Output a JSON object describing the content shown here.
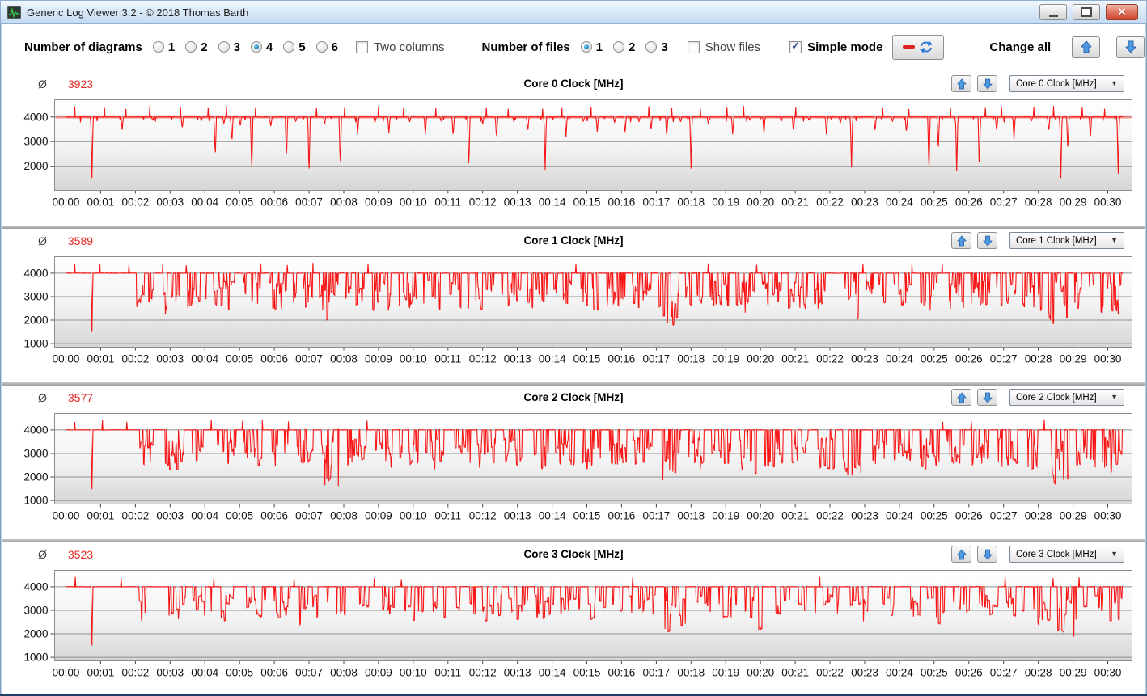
{
  "window": {
    "title": "Generic Log Viewer 3.2 - © 2018 Thomas Barth"
  },
  "titlebar_buttons": {
    "minimize": "minimize",
    "maximize": "maximize",
    "close": "close"
  },
  "colors": {
    "line_red": "#f81616",
    "avg_text_red": "#e62a24",
    "arrow_blue": "#4e9ae0",
    "titlebar_blue": "#c3d9f0",
    "frame_blue": "#bed4ec",
    "grid_gray": "#909090"
  },
  "toolbar": {
    "diagrams": {
      "label": "Number of diagrams",
      "options": [
        {
          "label": "1",
          "selected": false
        },
        {
          "label": "2",
          "selected": false
        },
        {
          "label": "3",
          "selected": false
        },
        {
          "label": "4",
          "selected": true
        },
        {
          "label": "5",
          "selected": false
        },
        {
          "label": "6",
          "selected": false
        }
      ]
    },
    "two_columns": {
      "label": "Two columns",
      "checked": false
    },
    "files": {
      "label": "Number of files",
      "options": [
        {
          "label": "1",
          "selected": true
        },
        {
          "label": "2",
          "selected": false
        },
        {
          "label": "3",
          "selected": false
        }
      ]
    },
    "show_files": {
      "label": "Show files",
      "checked": false
    },
    "simple_mode": {
      "label": "Simple mode",
      "checked": true
    },
    "refresh_button": {
      "icons": [
        "red-line-icon",
        "refresh-arrows-icon"
      ]
    },
    "change_all": {
      "label": "Change all",
      "buttons": [
        "up-arrow-icon",
        "down-arrow-icon"
      ]
    }
  },
  "panels_common": {
    "avg_symbol": "Ø",
    "chevron": "▼"
  },
  "chart_data": [
    {
      "type": "line",
      "title": "Core 0 Clock [MHz]",
      "average": 3923,
      "selector_value": "Core 0 Clock [MHz]",
      "ylabel": "",
      "xlabel": "",
      "ylim": [
        1020,
        4700
      ],
      "y_ticks": [
        4000,
        3000,
        2000
      ],
      "x_ticks": [
        "00:00",
        "00:01",
        "00:02",
        "00:03",
        "00:04",
        "00:05",
        "00:06",
        "00:07",
        "00:08",
        "00:09",
        "00:10",
        "00:11",
        "00:12",
        "00:13",
        "00:14",
        "00:15",
        "00:16",
        "00:17",
        "00:18",
        "00:19",
        "00:20",
        "00:21",
        "00:22",
        "00:23",
        "00:24",
        "00:25",
        "00:26",
        "00:27",
        "00:28",
        "00:29",
        "00:30"
      ],
      "grid": true,
      "legend": "none",
      "line_color": "#f81616",
      "baseline": 4000,
      "spike_max": 4450,
      "avg_band": true,
      "micro_dips": true,
      "seed": 11,
      "up_ratio": 0.45,
      "hold": 3,
      "dips": [
        [
          0.75,
          1520
        ],
        [
          1.62,
          3480
        ],
        [
          2.5,
          3850
        ],
        [
          3.35,
          3520
        ],
        [
          3.9,
          3850
        ],
        [
          4.3,
          2330
        ],
        [
          4.55,
          3700
        ],
        [
          4.78,
          2950
        ],
        [
          5.02,
          3600
        ],
        [
          5.35,
          1680
        ],
        [
          5.9,
          3570
        ],
        [
          6.35,
          2230
        ],
        [
          6.62,
          3800
        ],
        [
          7.0,
          1560
        ],
        [
          7.45,
          3700
        ],
        [
          7.9,
          1900
        ],
        [
          8.4,
          3300
        ],
        [
          8.9,
          3750
        ],
        [
          9.3,
          3350
        ],
        [
          9.9,
          3800
        ],
        [
          10.35,
          3300
        ],
        [
          10.8,
          3850
        ],
        [
          11.15,
          3200
        ],
        [
          11.6,
          1800
        ],
        [
          12.0,
          3700
        ],
        [
          12.4,
          3100
        ],
        [
          12.9,
          3800
        ],
        [
          13.3,
          3400
        ],
        [
          13.8,
          1850
        ],
        [
          14.4,
          3200
        ],
        [
          14.9,
          3800
        ],
        [
          15.3,
          3400
        ],
        [
          15.8,
          3750
        ],
        [
          16.1,
          3300
        ],
        [
          16.5,
          3800
        ],
        [
          16.85,
          3450
        ],
        [
          17.3,
          3200
        ],
        [
          17.7,
          3800
        ],
        [
          18.0,
          1900
        ],
        [
          18.5,
          3700
        ],
        [
          19.2,
          3300
        ],
        [
          19.7,
          3850
        ],
        [
          20.1,
          3350
        ],
        [
          20.6,
          3800
        ],
        [
          20.95,
          3400
        ],
        [
          21.4,
          3850
        ],
        [
          21.9,
          3300
        ],
        [
          22.3,
          3750
        ],
        [
          22.62,
          1950
        ],
        [
          23.3,
          3400
        ],
        [
          23.8,
          3800
        ],
        [
          24.2,
          3350
        ],
        [
          24.85,
          1700
        ],
        [
          25.12,
          2600
        ],
        [
          25.65,
          1800
        ],
        [
          26.3,
          1850
        ],
        [
          26.8,
          3400
        ],
        [
          27.3,
          3100
        ],
        [
          27.8,
          3800
        ],
        [
          28.3,
          3400
        ],
        [
          28.65,
          1520
        ],
        [
          28.85,
          2600
        ],
        [
          29.5,
          3100
        ],
        [
          30.3,
          1700
        ]
      ],
      "bursts": []
    },
    {
      "type": "line",
      "title": "Core 1 Clock [MHz]",
      "average": 3589,
      "selector_value": "Core 1 Clock [MHz]",
      "ylabel": "",
      "xlabel": "",
      "ylim": [
        850,
        4700
      ],
      "y_ticks": [
        4000,
        3000,
        2000,
        1000
      ],
      "x_ticks": [
        "00:00",
        "00:01",
        "00:02",
        "00:03",
        "00:04",
        "00:05",
        "00:06",
        "00:07",
        "00:08",
        "00:09",
        "00:10",
        "00:11",
        "00:12",
        "00:13",
        "00:14",
        "00:15",
        "00:16",
        "00:17",
        "00:18",
        "00:19",
        "00:20",
        "00:21",
        "00:22",
        "00:23",
        "00:24",
        "00:25",
        "00:26",
        "00:27",
        "00:28",
        "00:29",
        "00:30"
      ],
      "grid": true,
      "legend": "none",
      "line_color": "#f81616",
      "baseline": 4000,
      "spike_max": 4450,
      "avg_band": false,
      "micro_dips": false,
      "seed": 23,
      "up_ratio": 0.45,
      "hold": 3,
      "dips": [
        [
          0.75,
          1500,
          0.03
        ]
      ],
      "bursts": [
        [
          2.0,
          2.55,
          2500
        ],
        [
          2.8,
          3.3,
          2100
        ],
        [
          3.5,
          4.05,
          2500
        ],
        [
          4.25,
          4.85,
          2400
        ],
        [
          5.05,
          5.6,
          2550
        ],
        [
          5.8,
          6.35,
          2300
        ],
        [
          6.55,
          7.1,
          2500
        ],
        [
          7.3,
          7.85,
          1450
        ],
        [
          8.05,
          8.6,
          2500
        ],
        [
          8.8,
          9.35,
          2400
        ],
        [
          9.55,
          10.1,
          2550
        ],
        [
          10.3,
          10.85,
          2300
        ],
        [
          11.05,
          11.6,
          2500
        ],
        [
          11.8,
          12.35,
          2400
        ],
        [
          12.55,
          13.1,
          2550
        ],
        [
          13.3,
          13.85,
          2300
        ],
        [
          14.05,
          14.6,
          2500
        ],
        [
          14.8,
          15.35,
          2400
        ],
        [
          15.55,
          16.1,
          2500
        ],
        [
          16.3,
          16.85,
          2450
        ],
        [
          17.05,
          17.65,
          1800
        ],
        [
          17.85,
          18.35,
          2400
        ],
        [
          18.55,
          19.1,
          2500
        ],
        [
          19.3,
          19.85,
          2300
        ],
        [
          20.05,
          20.6,
          2450
        ],
        [
          20.8,
          21.35,
          2500
        ],
        [
          21.55,
          22.1,
          2400
        ],
        [
          22.3,
          22.85,
          2000
        ],
        [
          23.05,
          23.6,
          2450
        ],
        [
          23.8,
          24.35,
          2500
        ],
        [
          24.55,
          25.1,
          2300
        ],
        [
          25.3,
          25.85,
          2450
        ],
        [
          26.05,
          26.6,
          2500
        ],
        [
          26.8,
          27.35,
          2400
        ],
        [
          27.55,
          28.1,
          2300
        ],
        [
          28.3,
          28.85,
          1550
        ],
        [
          29.05,
          29.6,
          2400
        ],
        [
          29.8,
          30.42,
          2200
        ]
      ]
    },
    {
      "type": "line",
      "title": "Core 2 Clock [MHz]",
      "average": 3577,
      "selector_value": "Core 2 Clock [MHz]",
      "ylabel": "",
      "xlabel": "",
      "ylim": [
        850,
        4700
      ],
      "y_ticks": [
        4000,
        3000,
        2000,
        1000
      ],
      "x_ticks": [
        "00:00",
        "00:01",
        "00:02",
        "00:03",
        "00:04",
        "00:05",
        "00:06",
        "00:07",
        "00:08",
        "00:09",
        "00:10",
        "00:11",
        "00:12",
        "00:13",
        "00:14",
        "00:15",
        "00:16",
        "00:17",
        "00:18",
        "00:19",
        "00:20",
        "00:21",
        "00:22",
        "00:23",
        "00:24",
        "00:25",
        "00:26",
        "00:27",
        "00:28",
        "00:29",
        "00:30"
      ],
      "grid": true,
      "legend": "none",
      "line_color": "#f81616",
      "baseline": 4000,
      "spike_max": 4450,
      "avg_band": false,
      "micro_dips": false,
      "seed": 57,
      "up_ratio": 0.45,
      "hold": 3,
      "dips": [
        [
          0.75,
          1480,
          0.03
        ]
      ],
      "bursts": [
        [
          2.1,
          2.6,
          2400
        ],
        [
          2.85,
          3.4,
          2200
        ],
        [
          3.6,
          4.1,
          2500
        ],
        [
          4.3,
          4.9,
          2350
        ],
        [
          5.1,
          5.65,
          2500
        ],
        [
          5.85,
          6.4,
          2250
        ],
        [
          6.6,
          7.15,
          2450
        ],
        [
          7.35,
          7.9,
          1500
        ],
        [
          8.1,
          8.65,
          2500
        ],
        [
          8.85,
          9.4,
          2350
        ],
        [
          9.6,
          10.15,
          2500
        ],
        [
          10.35,
          10.9,
          2250
        ],
        [
          11.1,
          11.65,
          2500
        ],
        [
          11.85,
          12.4,
          2350
        ],
        [
          12.6,
          13.15,
          2500
        ],
        [
          13.35,
          13.9,
          2250
        ],
        [
          14.1,
          14.65,
          2500
        ],
        [
          14.85,
          15.4,
          2350
        ],
        [
          15.6,
          16.15,
          2500
        ],
        [
          16.35,
          16.9,
          2400
        ],
        [
          17.1,
          17.7,
          1850
        ],
        [
          17.9,
          18.4,
          2350
        ],
        [
          18.6,
          19.15,
          2500
        ],
        [
          19.35,
          19.9,
          2150
        ],
        [
          20.1,
          20.65,
          2400
        ],
        [
          20.85,
          21.4,
          2500
        ],
        [
          21.6,
          22.15,
          2350
        ],
        [
          22.35,
          22.9,
          2050
        ],
        [
          23.1,
          23.65,
          2400
        ],
        [
          23.85,
          24.4,
          2500
        ],
        [
          24.6,
          25.15,
          2250
        ],
        [
          25.35,
          25.9,
          2400
        ],
        [
          26.1,
          26.65,
          2500
        ],
        [
          26.85,
          27.4,
          2350
        ],
        [
          27.6,
          28.15,
          2250
        ],
        [
          28.35,
          28.9,
          1600
        ],
        [
          29.1,
          29.65,
          2350
        ],
        [
          29.85,
          30.42,
          2150
        ]
      ]
    },
    {
      "type": "line",
      "title": "Core 3 Clock [MHz]",
      "average": 3523,
      "selector_value": "Core 3 Clock [MHz]",
      "ylabel": "",
      "xlabel": "",
      "ylim": [
        850,
        4700
      ],
      "y_ticks": [
        4000,
        3000,
        2000,
        1000
      ],
      "x_ticks": [
        "00:00",
        "00:01",
        "00:02",
        "00:03",
        "00:04",
        "00:05",
        "00:06",
        "00:07",
        "00:08",
        "00:09",
        "00:10",
        "00:11",
        "00:12",
        "00:13",
        "00:14",
        "00:15",
        "00:16",
        "00:17",
        "00:18",
        "00:19",
        "00:20",
        "00:21",
        "00:22",
        "00:23",
        "00:24",
        "00:25",
        "00:26",
        "00:27",
        "00:28",
        "00:29",
        "00:30"
      ],
      "grid": true,
      "legend": "none",
      "line_color": "#f81616",
      "baseline": 4000,
      "spike_max": 4450,
      "avg_band": false,
      "micro_dips": false,
      "seed": 83,
      "up_ratio": 0.5,
      "hold": 5,
      "dips": [
        [
          0.75,
          1500,
          0.03
        ]
      ],
      "bursts": [
        [
          2.05,
          2.65,
          2600
        ],
        [
          2.9,
          3.45,
          2650
        ],
        [
          3.65,
          4.2,
          2550
        ],
        [
          4.4,
          5.0,
          2300
        ],
        [
          5.2,
          5.75,
          2650
        ],
        [
          5.95,
          6.5,
          2600
        ],
        [
          6.7,
          7.25,
          2250
        ],
        [
          7.45,
          8.05,
          1550
        ],
        [
          8.25,
          8.8,
          2600
        ],
        [
          9.0,
          9.55,
          2650
        ],
        [
          9.75,
          10.3,
          2550
        ],
        [
          10.5,
          11.05,
          2600
        ],
        [
          11.25,
          11.8,
          2650
        ],
        [
          12.0,
          12.55,
          2550
        ],
        [
          12.75,
          13.3,
          2600
        ],
        [
          13.5,
          14.05,
          2650
        ],
        [
          14.25,
          14.8,
          2550
        ],
        [
          15.0,
          15.55,
          2600
        ],
        [
          15.75,
          16.3,
          2650
        ],
        [
          16.5,
          17.05,
          2550
        ],
        [
          17.25,
          17.85,
          1900
        ],
        [
          18.05,
          18.6,
          2600
        ],
        [
          18.8,
          19.35,
          2650
        ],
        [
          19.55,
          20.1,
          2200
        ],
        [
          20.3,
          20.85,
          2550
        ],
        [
          21.05,
          21.6,
          2600
        ],
        [
          21.8,
          22.35,
          2650
        ],
        [
          22.55,
          23.1,
          2100
        ],
        [
          23.3,
          23.85,
          2550
        ],
        [
          24.05,
          24.6,
          2600
        ],
        [
          24.8,
          25.35,
          2300
        ],
        [
          25.55,
          26.1,
          2550
        ],
        [
          26.3,
          26.85,
          2600
        ],
        [
          27.05,
          27.6,
          2650
        ],
        [
          27.8,
          28.35,
          2350
        ],
        [
          28.55,
          29.1,
          1600
        ],
        [
          29.3,
          29.85,
          2550
        ],
        [
          30.05,
          30.42,
          2250
        ]
      ]
    }
  ]
}
